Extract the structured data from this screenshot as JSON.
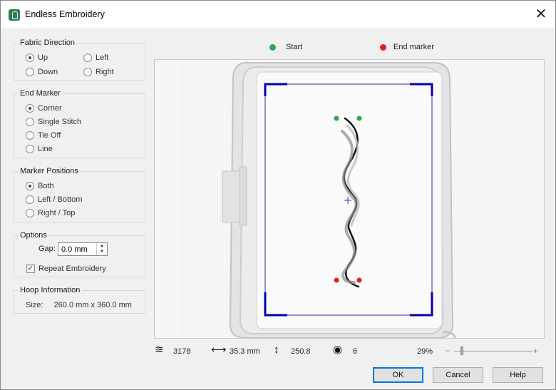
{
  "window": {
    "title": "Endless Embroidery",
    "close_label": "✕"
  },
  "fabric_direction": {
    "title": "Fabric Direction",
    "options": [
      {
        "label": "Up",
        "selected": true
      },
      {
        "label": "Left",
        "selected": false
      },
      {
        "label": "Down",
        "selected": false
      },
      {
        "label": "Right",
        "selected": false
      }
    ]
  },
  "end_marker": {
    "title": "End Marker",
    "options": [
      {
        "label": "Corner",
        "selected": true
      },
      {
        "label": "Single Stitch",
        "selected": false
      },
      {
        "label": "Tie Off",
        "selected": false
      },
      {
        "label": "Line",
        "selected": false
      }
    ]
  },
  "marker_positions": {
    "title": "Marker Positions",
    "options": [
      {
        "label": "Both",
        "selected": true
      },
      {
        "label": "Left / Bottom",
        "selected": false
      },
      {
        "label": "Right / Top",
        "selected": false
      }
    ]
  },
  "options": {
    "title": "Options",
    "gap_label": "Gap:",
    "gap_value": "0.0 mm",
    "repeat_label": "Repeat Embroidery",
    "repeat_checked": true
  },
  "hoop_information": {
    "title": "Hoop Information",
    "size_label": "Size:",
    "size_value": "260.0 mm x 360.0 mm"
  },
  "legend": {
    "start_label": "Start",
    "start_color": "#2ea84a",
    "end_label": "End marker",
    "end_color": "#e02020"
  },
  "status": {
    "stitches": "3178",
    "width": "35.3 mm",
    "height": "250.8",
    "colors": "6",
    "zoom": "29%",
    "zoom_minus": "−",
    "zoom_plus": "+"
  },
  "buttons": {
    "ok": "OK",
    "cancel": "Cancel",
    "help": "Help"
  },
  "colors": {
    "hoop_frame": "#0000aa",
    "start_marker": "#2ea84a",
    "end_marker": "#e02020"
  }
}
